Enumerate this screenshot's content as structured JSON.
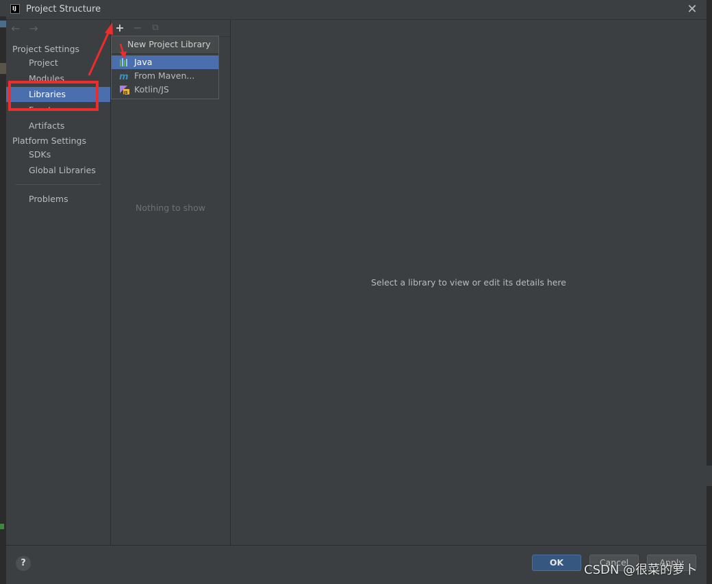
{
  "window": {
    "title": "Project Structure",
    "app_icon_text": "IJ",
    "close_symbol": "✕"
  },
  "sidebar": {
    "back_symbol": "←",
    "forward_symbol": "→",
    "sections": [
      {
        "label": "Project Settings",
        "items": [
          "Project",
          "Modules",
          "Libraries",
          "Facets",
          "Artifacts"
        ]
      },
      {
        "label": "Platform Settings",
        "items": [
          "SDKs",
          "Global Libraries"
        ]
      }
    ],
    "extra_items": [
      "Problems"
    ],
    "selected": "Libraries"
  },
  "middle": {
    "toolbar": {
      "add": "+",
      "remove": "−",
      "copy": "⧉"
    },
    "empty_text": "Nothing to show"
  },
  "popup": {
    "title": "New Project Library",
    "items": [
      {
        "label": "Java",
        "icon": "java-library-icon",
        "selected": true
      },
      {
        "label": "From Maven...",
        "icon": "maven-icon",
        "selected": false
      },
      {
        "label": "Kotlin/JS",
        "icon": "kotlin-js-icon",
        "selected": false
      }
    ]
  },
  "details": {
    "placeholder": "Select a library to view or edit its details here"
  },
  "footer": {
    "help": "?",
    "ok": "OK",
    "cancel": "Cancel",
    "apply": "Apply"
  },
  "watermark": "CSDN @很菜的萝卜",
  "colors": {
    "selection": "#4b6eaf",
    "annotation_red": "#ee2c2c",
    "ok_button": "#365880"
  }
}
